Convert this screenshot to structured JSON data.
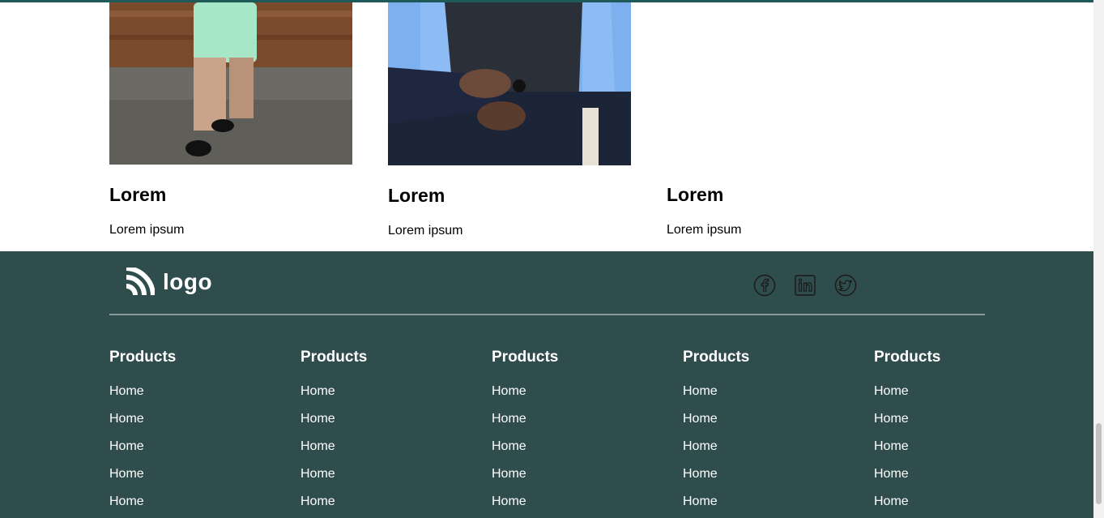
{
  "cards": [
    {
      "title": "Lorem",
      "text": "Lorem ipsum"
    },
    {
      "title": "Lorem",
      "text": "Lorem ipsum"
    },
    {
      "title": "Lorem",
      "text": "Lorem ipsum"
    }
  ],
  "footer": {
    "logo_text": "logo",
    "socials": [
      "facebook-icon",
      "linkedin-icon",
      "twitter-icon"
    ],
    "columns": [
      {
        "heading": "Products",
        "links": [
          "Home",
          "Home",
          "Home",
          "Home",
          "Home"
        ]
      },
      {
        "heading": "Products",
        "links": [
          "Home",
          "Home",
          "Home",
          "Home",
          "Home"
        ]
      },
      {
        "heading": "Products",
        "links": [
          "Home",
          "Home",
          "Home",
          "Home",
          "Home"
        ]
      },
      {
        "heading": "Products",
        "links": [
          "Home",
          "Home",
          "Home",
          "Home",
          "Home"
        ]
      },
      {
        "heading": "Products",
        "links": [
          "Home",
          "Home",
          "Home",
          "Home",
          "Home"
        ]
      }
    ]
  },
  "colors": {
    "footer_bg": "#2f4d4c",
    "accent_strip": "#1d5a58"
  }
}
